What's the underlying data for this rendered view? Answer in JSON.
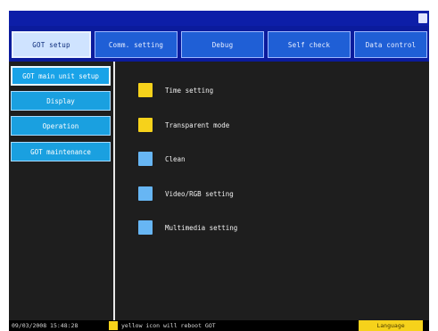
{
  "tabs": [
    {
      "label": "GOT setup"
    },
    {
      "label": "Comm. setting"
    },
    {
      "label": "Debug"
    },
    {
      "label": "Self check"
    },
    {
      "label": "Data control"
    }
  ],
  "sidebar": {
    "items": [
      {
        "label": "GOT main unit setup"
      },
      {
        "label": "Display"
      },
      {
        "label": "Operation"
      },
      {
        "label": "GOT maintenance"
      }
    ]
  },
  "main": {
    "items": [
      {
        "label": "Time setting",
        "icon": "yellow-square-icon",
        "color": "#f6d21b"
      },
      {
        "label": "Transparent mode",
        "icon": "yellow-square-icon",
        "color": "#f6d21b"
      },
      {
        "label": "Clean",
        "icon": "blue-square-icon",
        "color": "#67b6f4"
      },
      {
        "label": "Video/RGB setting",
        "icon": "blue-square-icon",
        "color": "#67b6f4"
      },
      {
        "label": "Multimedia setting",
        "icon": "blue-square-icon",
        "color": "#67b6f4"
      }
    ]
  },
  "statusbar": {
    "datetime": "09/03/2008 15:48:28",
    "note": "yellow icon will reboot GOT",
    "language_label": "Language"
  },
  "colors": {
    "titlebar": "#0d1ea8",
    "tab": "#1f5fd6",
    "tab_active": "#cfe3ff",
    "sidebar_button": "#1aa0e0",
    "background": "#1e1e1e",
    "yellow": "#f6d21b",
    "blue": "#67b6f4"
  }
}
